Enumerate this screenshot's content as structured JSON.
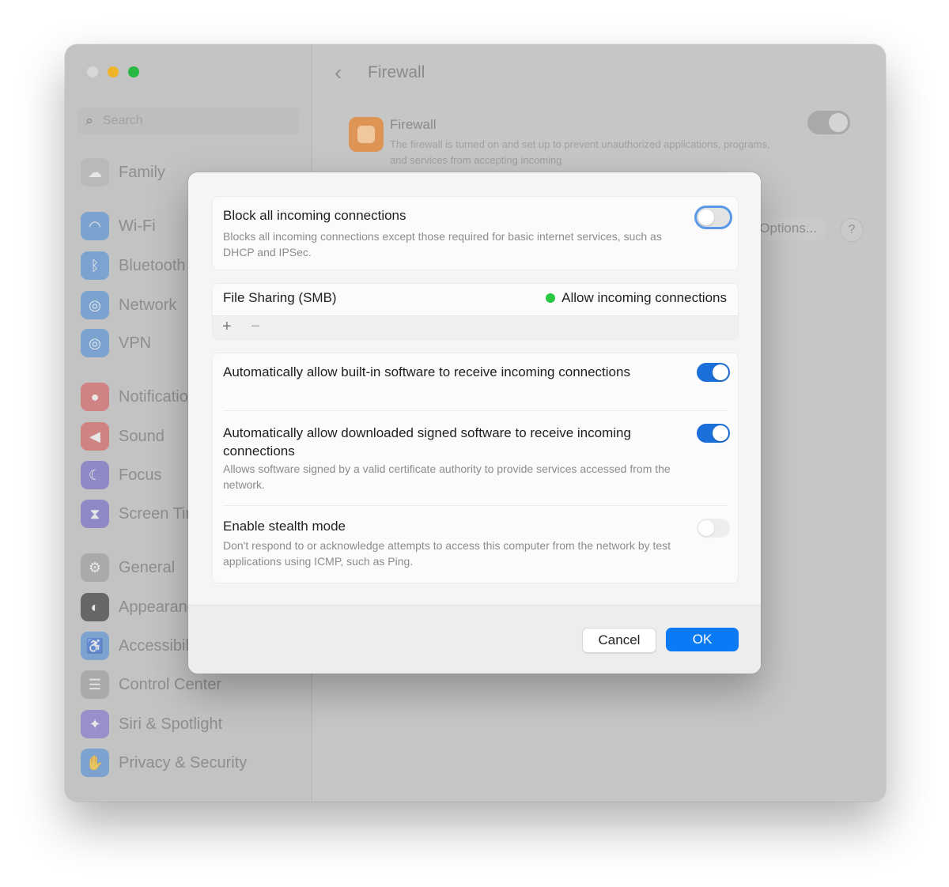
{
  "window": {
    "sidebar": {
      "search_placeholder": "Search",
      "items": [
        {
          "label": "Family",
          "icon": "family-icon",
          "color": "#b3b3b3"
        },
        {
          "label": "Wi-Fi",
          "icon": "wifi-icon",
          "color": "#4d8fd9"
        },
        {
          "label": "Bluetooth",
          "icon": "bluetooth-icon",
          "color": "#4d8fd9"
        },
        {
          "label": "Network",
          "icon": "network-icon",
          "color": "#4d8fd9"
        },
        {
          "label": "VPN",
          "icon": "vpn-icon",
          "color": "#4d8fd9"
        },
        {
          "label": "Notifications",
          "icon": "notifications-icon",
          "color": "#d9595a"
        },
        {
          "label": "Sound",
          "icon": "sound-icon",
          "color": "#d9595a"
        },
        {
          "label": "Focus",
          "icon": "focus-icon",
          "color": "#6d63c9"
        },
        {
          "label": "Screen Time",
          "icon": "screen-time-icon",
          "color": "#6d63c9"
        },
        {
          "label": "General",
          "icon": "general-icon",
          "color": "#9a9a9a"
        },
        {
          "label": "Appearance",
          "icon": "appearance-icon",
          "color": "#2a2a2a"
        },
        {
          "label": "Accessibility",
          "icon": "accessibility-icon",
          "color": "#4d8fd9"
        },
        {
          "label": "Control Center",
          "icon": "control-center-icon",
          "color": "#9a9a9a"
        },
        {
          "label": "Siri & Spotlight",
          "icon": "siri-icon",
          "color": "#7b6fcf"
        },
        {
          "label": "Privacy & Security",
          "icon": "privacy-icon",
          "color": "#4d8fd9"
        }
      ]
    },
    "main": {
      "title": "Firewall",
      "firewall_name": "Firewall",
      "firewall_desc": "The firewall is turned on and set up to prevent unauthorized applications, programs, and services from accepting incoming",
      "firewall_on": true,
      "options_label": "Options...",
      "help_label": "?"
    }
  },
  "modal": {
    "block_all": {
      "title": "Block all incoming connections",
      "desc": "Blocks all incoming connections except those required for basic internet services, such as DHCP and IPSec.",
      "on": false
    },
    "apps": [
      {
        "name": "File Sharing (SMB)",
        "status": "Allow incoming connections",
        "status_color": "#28c840"
      }
    ],
    "add_label": "+",
    "remove_label": "−",
    "builtin": {
      "title": "Automatically allow built-in software to receive incoming connections",
      "on": true
    },
    "signed": {
      "title": "Automatically allow downloaded signed software to receive incoming connections",
      "desc": "Allows software signed by a valid certificate authority to provide services accessed from the network.",
      "on": true
    },
    "stealth": {
      "title": "Enable stealth mode",
      "desc": "Don't respond to or acknowledge attempts to access this computer from the network by test applications using ICMP, such as Ping.",
      "on": false
    },
    "cancel_label": "Cancel",
    "ok_label": "OK",
    "accent": "#0a7bf5"
  }
}
